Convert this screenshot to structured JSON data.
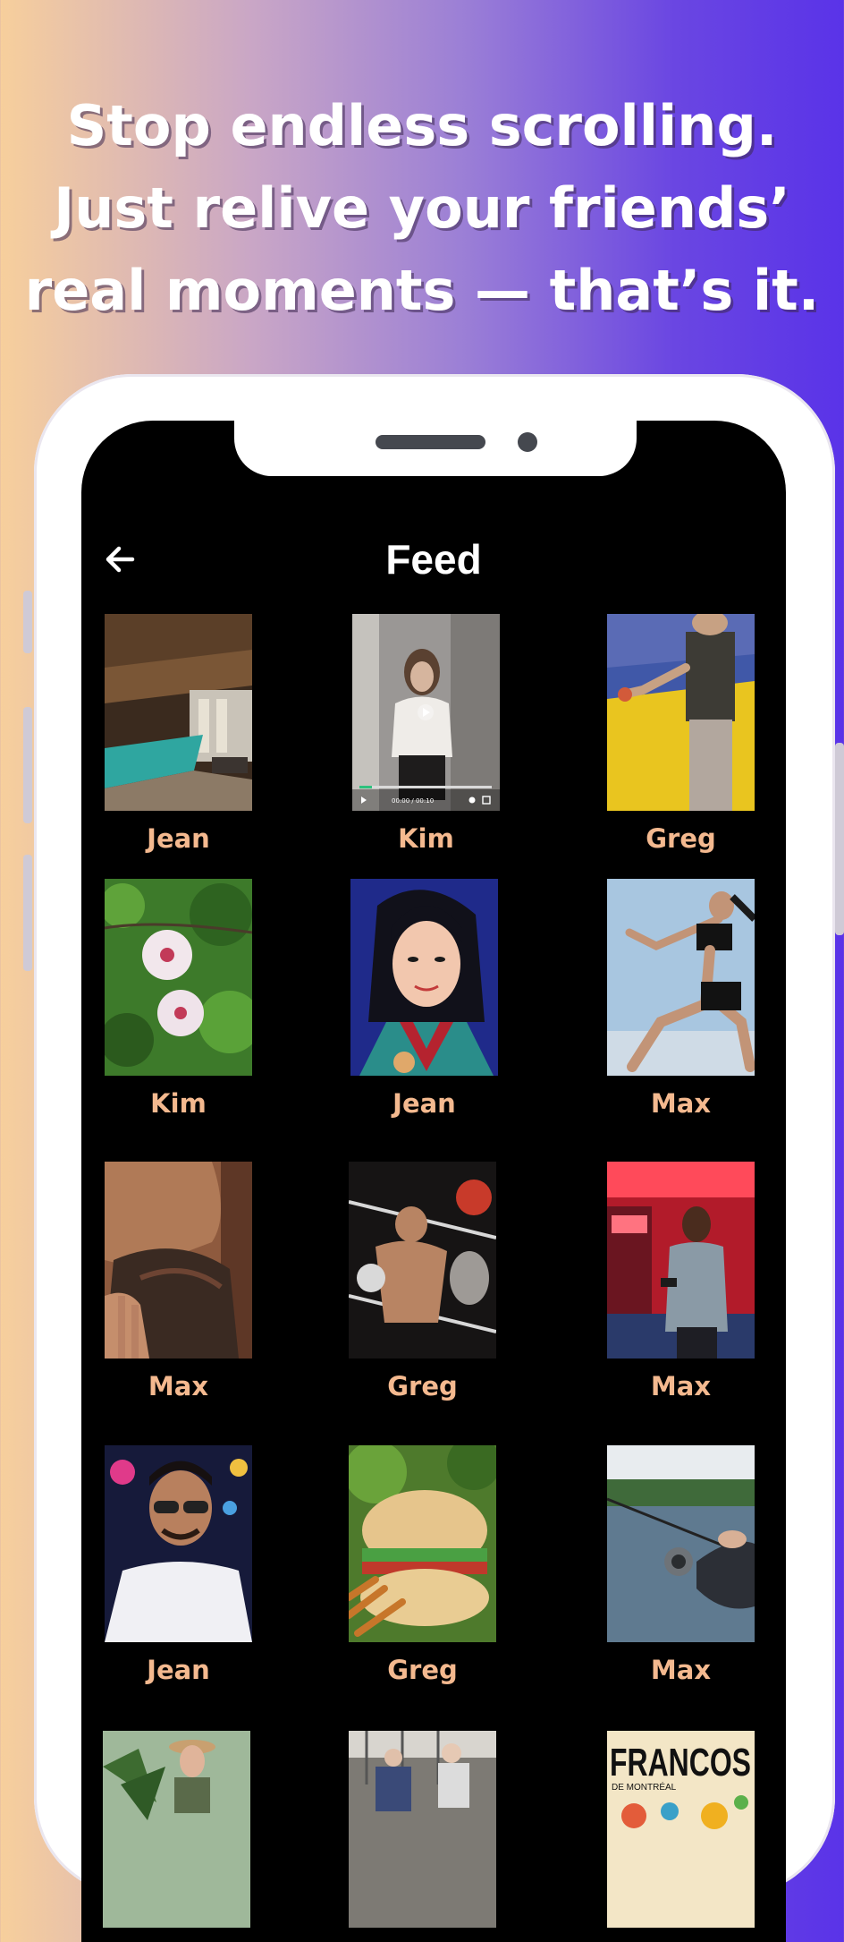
{
  "headline": "Stop endless scrolling. Just relive your friends’ real moments — that’s it.",
  "header": {
    "title": "Feed",
    "back_icon": "arrow-left-icon"
  },
  "colors": {
    "name_text": "#f4b98f",
    "screen_bg": "#000000",
    "gradient_start": "#f7cf9c",
    "gradient_end": "#5a33e8"
  },
  "feed": [
    {
      "name": "Jean",
      "thumb": "indoor-pool-photo"
    },
    {
      "name": "Kim",
      "thumb": "woman-video-clip"
    },
    {
      "name": "Greg",
      "thumb": "gym-floor-photo"
    },
    {
      "name": "Kim",
      "thumb": "white-flowers-photo"
    },
    {
      "name": "Jean",
      "thumb": "animated-heroine-image"
    },
    {
      "name": "Max",
      "thumb": "runner-photo"
    },
    {
      "name": "Max",
      "thumb": "bearded-face-photo"
    },
    {
      "name": "Greg",
      "thumb": "boxing-match-photo"
    },
    {
      "name": "Max",
      "thumb": "man-in-neon-shop-photo"
    },
    {
      "name": "Jean",
      "thumb": "man-in-sunglasses-photo"
    },
    {
      "name": "Greg",
      "thumb": "burger-photo"
    },
    {
      "name": "Max",
      "thumb": "fishing-rod-photo"
    },
    {
      "name": "",
      "thumb": "woman-with-hat-photo"
    },
    {
      "name": "",
      "thumb": "street-couple-photo"
    },
    {
      "name": "",
      "thumb": "festival-poster-image",
      "overlay_text": "FRANCOS",
      "overlay_sub": "DE MONTRÉAL"
    }
  ],
  "video_player": {
    "time": "00:00 / 00:10"
  }
}
